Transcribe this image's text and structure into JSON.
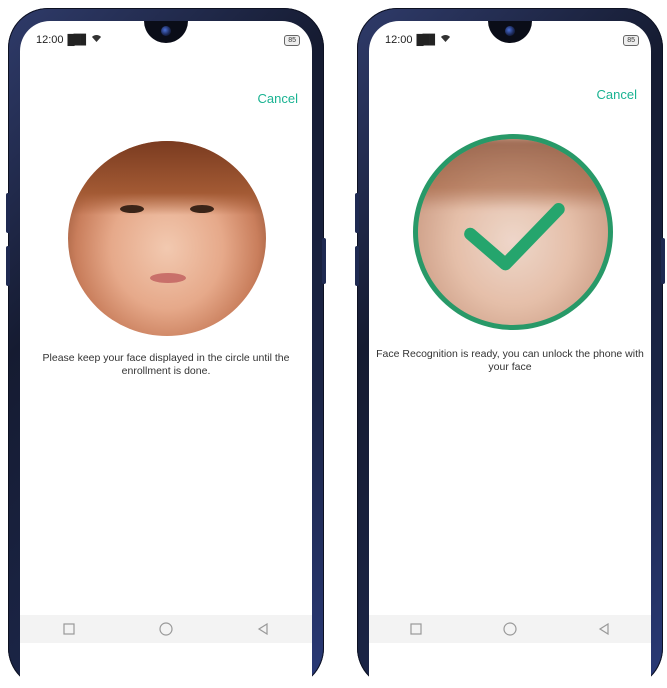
{
  "screens": [
    {
      "status": {
        "time": "12:00",
        "battery": "85"
      },
      "cancel_label": "Cancel",
      "message": "Please keep your face displayed in the circle until the enrollment is done."
    },
    {
      "status": {
        "time": "12:00",
        "battery": "85"
      },
      "cancel_label": "Cancel",
      "message": "Face Recognition is ready, you can unlock the phone with your face"
    }
  ],
  "icons": {
    "signal": "signal-icon",
    "wifi": "wifi-icon",
    "check": "check-icon",
    "recents": "square-icon",
    "home": "circle-icon",
    "back": "triangle-back-icon"
  },
  "colors": {
    "accent": "#1ab392",
    "ring": "#1e9c66"
  }
}
